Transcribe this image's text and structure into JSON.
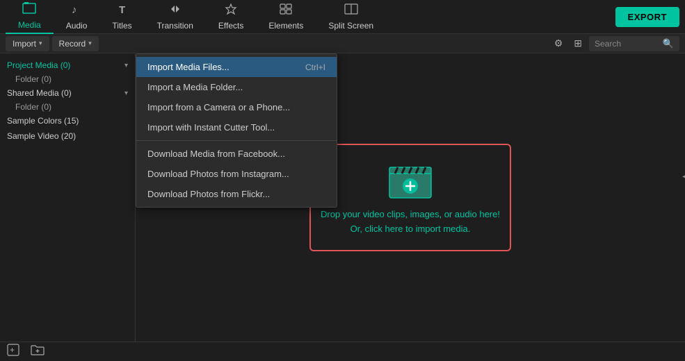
{
  "topNav": {
    "items": [
      {
        "id": "media",
        "label": "Media",
        "icon": "🗂",
        "active": true
      },
      {
        "id": "audio",
        "label": "Audio",
        "icon": "♪"
      },
      {
        "id": "titles",
        "label": "Titles",
        "icon": "T"
      },
      {
        "id": "transition",
        "label": "Transition",
        "icon": "↔"
      },
      {
        "id": "effects",
        "label": "Effects",
        "icon": "✦"
      },
      {
        "id": "elements",
        "label": "Elements",
        "icon": "⊞"
      },
      {
        "id": "splitscreen",
        "label": "Split Screen",
        "icon": "▣"
      }
    ],
    "exportLabel": "EXPORT"
  },
  "toolbar": {
    "importLabel": "Import",
    "recordLabel": "Record",
    "searchPlaceholder": "Search"
  },
  "sidebar": {
    "items": [
      {
        "id": "project-media",
        "label": "Project Media (0)",
        "active": true,
        "hasChevron": true
      },
      {
        "id": "project-folder",
        "label": "Folder (0)",
        "sub": true
      },
      {
        "id": "shared-media",
        "label": "Shared Media (0)",
        "hasChevron": true
      },
      {
        "id": "shared-folder",
        "label": "Folder (0)",
        "sub": true
      },
      {
        "id": "sample-colors",
        "label": "Sample Colors (15)"
      },
      {
        "id": "sample-video",
        "label": "Sample Video (20)"
      }
    ]
  },
  "dropdown": {
    "items": [
      {
        "id": "import-files",
        "label": "Import Media Files...",
        "shortcut": "Ctrl+I",
        "highlighted": true
      },
      {
        "id": "import-folder",
        "label": "Import a Media Folder..."
      },
      {
        "id": "import-camera",
        "label": "Import from a Camera or a Phone..."
      },
      {
        "id": "import-instant",
        "label": "Import with Instant Cutter Tool..."
      },
      {
        "separator": true
      },
      {
        "id": "download-facebook",
        "label": "Download Media from Facebook..."
      },
      {
        "id": "download-instagram",
        "label": "Download Photos from Instagram..."
      },
      {
        "id": "download-flickr",
        "label": "Download Photos from Flickr..."
      }
    ]
  },
  "dropzone": {
    "line1": "Drop your video clips, images, or audio here!",
    "line2": "Or, click here to import media."
  },
  "bottomBar": {
    "addIcon": "➕",
    "folderIcon": "📁"
  }
}
